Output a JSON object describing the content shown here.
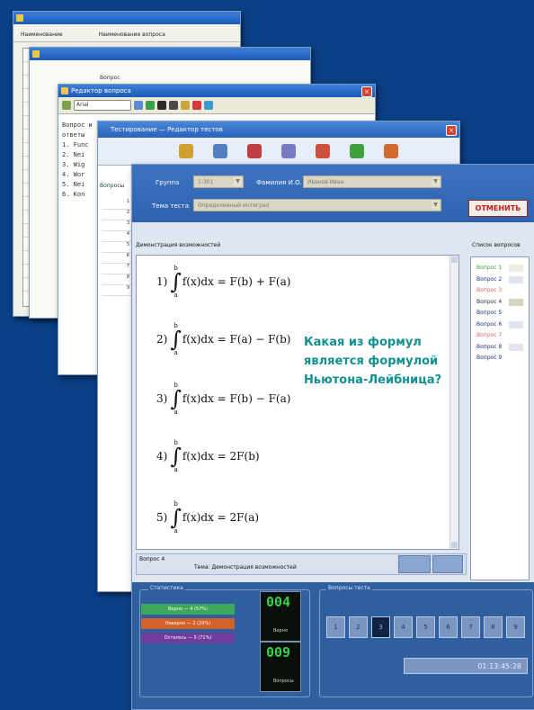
{
  "window1": {
    "col_left": "Наименование",
    "col_right": "Наименование вопроса"
  },
  "window2": {
    "label": "Вопрос"
  },
  "window3": {
    "title": "Редактор вопроса",
    "combo_value": "Arial",
    "code_lines": [
      "Вопрос и",
      "ответы",
      "",
      "1. Func",
      "2. Nei",
      "3. Wig",
      "4. Wor",
      "5. Nei",
      "6. Kon"
    ]
  },
  "window4": {
    "title": "Тестирование — Редактор тестов",
    "side_label": "Вопросы",
    "grid_numbers": [
      "1",
      "2",
      "3",
      "4",
      "5",
      "6",
      "7",
      "8",
      "9"
    ]
  },
  "main": {
    "group_label": "Группа",
    "group_value": "1-301",
    "student_label": "Фамилия И.О.",
    "student_value": "Иванов Иван",
    "topic_label": "Тема теста",
    "topic_value": "Определенный интеграл",
    "exit_button": "ОТМЕНИТЬ",
    "question_caption": "Демонстрация возможностей",
    "list_caption": "Список вопросов",
    "options": [
      {
        "num": "1)",
        "upper": "b",
        "lower": "a",
        "expr": "f(x)dx = F(b) + F(a)"
      },
      {
        "num": "2)",
        "upper": "b",
        "lower": "a",
        "expr": "f(x)dx = F(a) − F(b)"
      },
      {
        "num": "3)",
        "upper": "b",
        "lower": "a",
        "expr": "f(x)dx = F(b) − F(a)"
      },
      {
        "num": "4)",
        "upper": "b",
        "lower": "a",
        "expr": "f(x)dx = 2F(b)"
      },
      {
        "num": "5)",
        "upper": "b",
        "lower": "a",
        "expr": "f(x)dx = 2F(a)"
      }
    ],
    "question_text": "Какая из формул является формулой Ньютона-Лейбница?",
    "question_list": [
      {
        "label": "Вопрос 1",
        "color": "#3e9a3e",
        "box": "#e7efe0"
      },
      {
        "label": "Вопрос 2",
        "color": "#1e2e7e",
        "box": "#dfe4ef"
      },
      {
        "label": "Вопрос 3",
        "color": "#d26565",
        "box": "#ffffff"
      },
      {
        "label": "Вопрос 4",
        "color": "#2e2e2e",
        "box": "#d8d4c0"
      },
      {
        "label": "Вопрос 5",
        "color": "#1e2e7e",
        "box": "#ffffff"
      },
      {
        "label": "Вопрос 6",
        "color": "#1e2e7e",
        "box": "#dfe4ef"
      },
      {
        "label": "Вопрос 7",
        "color": "#d26565",
        "box": "#ffffff"
      },
      {
        "label": "Вопрос 8",
        "color": "#1e2e7e",
        "box": "#dfe4ef"
      },
      {
        "label": "Вопрос 9",
        "color": "#1e2e7e",
        "box": "#ffffff"
      }
    ],
    "status_question": "Вопрос 4",
    "status_topic": "Тема: Демонстрация возможностей",
    "stats_group_label": "Статистика",
    "bars": [
      {
        "text": "Верно — 4 (57%)",
        "color": "#3ea85a"
      },
      {
        "text": "Неверно — 2 (29%)",
        "color": "#d2612a"
      },
      {
        "text": "Осталось — 5 (71%)",
        "color": "#6e3e9e"
      }
    ],
    "digital_top": "004",
    "digital_top_sub": "Верно",
    "digital_bottom": "009",
    "digital_bottom_sub": "Вопросы",
    "nav_group_label": "Вопросы теста",
    "nav_numbers": [
      "1",
      "2",
      "3",
      "4",
      "5",
      "6",
      "7",
      "8",
      "9"
    ],
    "timer": "01:13:45:28"
  }
}
